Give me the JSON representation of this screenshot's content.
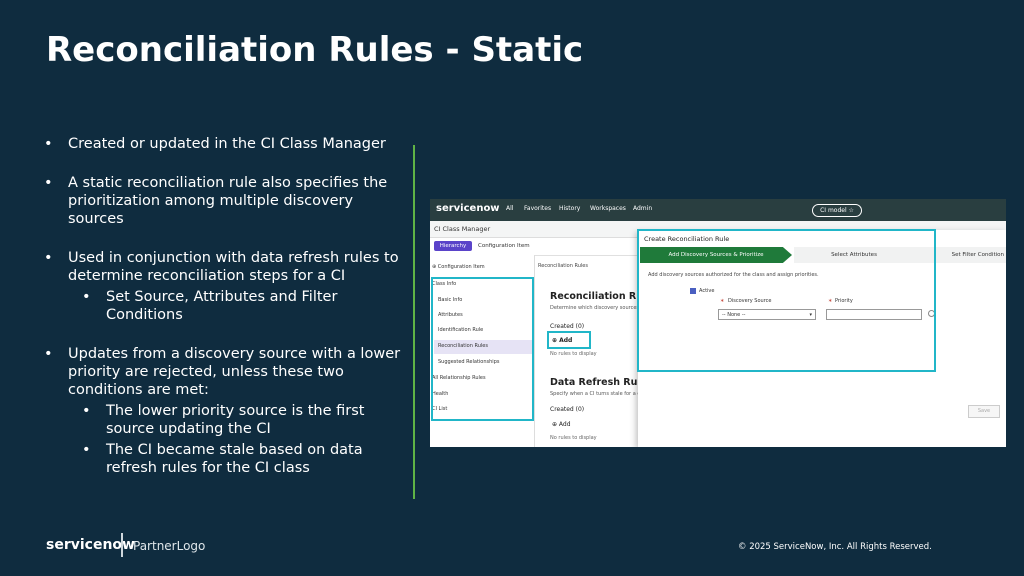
{
  "slide": {
    "title": "Reconciliation Rules - Static",
    "bullets": [
      "Created or updated in the CI Class Manager",
      "A static reconciliation rule also specifies the prioritization among multiple discovery sources",
      "Used in conjunction with data refresh rules to determine reconciliation steps for a CI",
      "Set Source, Attributes and Filter Conditions",
      "Updates from a discovery source with a lower priority are rejected, unless these two conditions are met:",
      "The lower priority source is the first source updating the CI",
      "The CI became stale based on data refresh rules for the CI class"
    ]
  },
  "screenshot": {
    "logo": "servicenow",
    "nav": [
      "All",
      "Favorites",
      "History",
      "Workspaces",
      "Admin"
    ],
    "ci_model": "CI model ☆",
    "app_title": "CI Class Manager",
    "hierarchy_button": "Hierarchy",
    "config_tab": "Configuration Item",
    "left_panel_header": "⊕ Configuration Item",
    "left_items": [
      "Class Info",
      "Basic Info",
      "Attributes",
      "Identification Rule",
      "Reconciliation Rules",
      "Suggested Relationships",
      "All Relationship Rules",
      "Health",
      "CI List"
    ],
    "breadcrumb": "Reconciliation Rules",
    "reconciliation_title": "Reconciliation Rules",
    "reconciliation_desc": "Determine which discovery sources a",
    "created_label": "Created (0)",
    "add_label": "⊕ Add",
    "no_rules": "No rules to display",
    "data_refresh_title": "Data Refresh Rules",
    "data_refresh_desc": "Specify when a CI turns stale for a disc",
    "modal": {
      "title": "Create Reconciliation Rule",
      "steps": [
        "Add Discovery Sources & Prioritize",
        "Select Attributes",
        "Set Filter Condition"
      ],
      "desc": "Add discovery sources authorized for the class and assign priorities.",
      "active_label": "Active",
      "source_label": "Discovery Source",
      "priority_label": "Priority",
      "select_value": "-- None --",
      "save_label": "Save"
    }
  },
  "footer": {
    "logo": "servicenow",
    "partner": "PartnerLogo",
    "copyright": "© 2025 ServiceNow, Inc. All Rights Reserved."
  },
  "colors": {
    "background": "#0f2c3f",
    "accent_green": "#5fb346",
    "highlight_cyan": "#21b6c8",
    "step_active": "#1f7a3a"
  }
}
